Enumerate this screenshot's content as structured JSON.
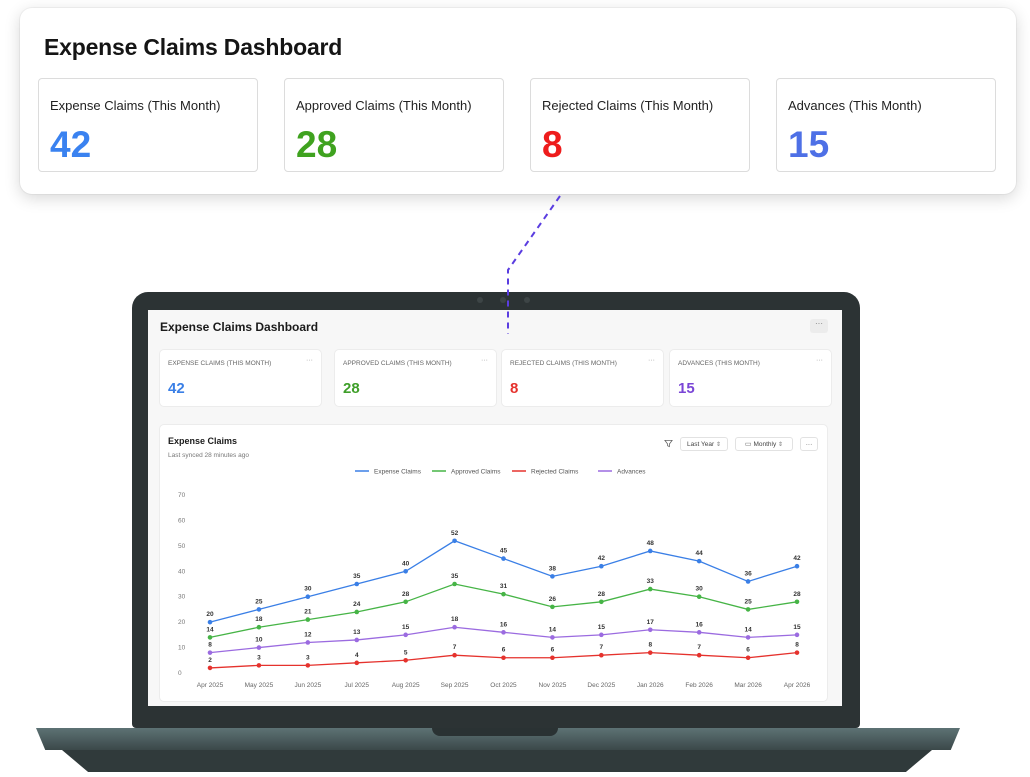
{
  "top": {
    "title": "Expense Claims Dashboard",
    "kpis": [
      {
        "label": "Expense Claims (This Month)",
        "value": "42",
        "color": "#3a82f0"
      },
      {
        "label": "Approved Claims (This Month)",
        "value": "28",
        "color": "#3fa21f"
      },
      {
        "label": "Rejected Claims (This Month)",
        "value": "8",
        "color": "#ee1c1c"
      },
      {
        "label": "Advances (This Month)",
        "value": "15",
        "color": "#4e70e6"
      }
    ]
  },
  "screen": {
    "title": "Expense Claims Dashboard",
    "more": "···",
    "kpis": [
      {
        "label": "EXPENSE CLAIMS (THIS MONTH)",
        "value": "42",
        "color": "#3a7fe6"
      },
      {
        "label": "APPROVED CLAIMS (THIS MONTH)",
        "value": "28",
        "color": "#3f9f2a"
      },
      {
        "label": "REJECTED CLAIMS (THIS MONTH)",
        "value": "8",
        "color": "#e5322d"
      },
      {
        "label": "ADVANCES (THIS MONTH)",
        "value": "15",
        "color": "#7a45d6"
      }
    ],
    "panel": {
      "title": "Expense Claims",
      "subtitle": "Last synced 28 minutes ago",
      "filter_icon": "filter-icon",
      "range": "Last Year",
      "period": "Monthly",
      "more": "···"
    }
  },
  "chart_data": {
    "type": "line",
    "categories": [
      "Apr 2025",
      "May 2025",
      "Jun 2025",
      "Jul 2025",
      "Aug 2025",
      "Sep 2025",
      "Oct 2025",
      "Nov 2025",
      "Dec 2025",
      "Jan 2026",
      "Feb 2026",
      "Mar 2026",
      "Apr 2026"
    ],
    "series": [
      {
        "name": "Expense Claims",
        "color": "#3a7fe6",
        "values": [
          20,
          25,
          30,
          35,
          40,
          52,
          45,
          38,
          42,
          48,
          44,
          36,
          42
        ]
      },
      {
        "name": "Approved Claims",
        "color": "#46b446",
        "values": [
          14,
          18,
          21,
          24,
          28,
          35,
          31,
          26,
          28,
          33,
          30,
          25,
          28
        ]
      },
      {
        "name": "Rejected Claims",
        "color": "#e5322d",
        "values": [
          2,
          3,
          3,
          4,
          5,
          7,
          6,
          6,
          7,
          8,
          7,
          6,
          8
        ]
      },
      {
        "name": "Advances",
        "color": "#9b6be0",
        "values": [
          8,
          10,
          12,
          13,
          15,
          18,
          16,
          14,
          15,
          17,
          16,
          14,
          15
        ]
      }
    ],
    "yticks": [
      0,
      10,
      20,
      30,
      40,
      50,
      60,
      70
    ],
    "ylim": [
      0,
      70
    ],
    "grid": false,
    "legend": "top-center"
  }
}
